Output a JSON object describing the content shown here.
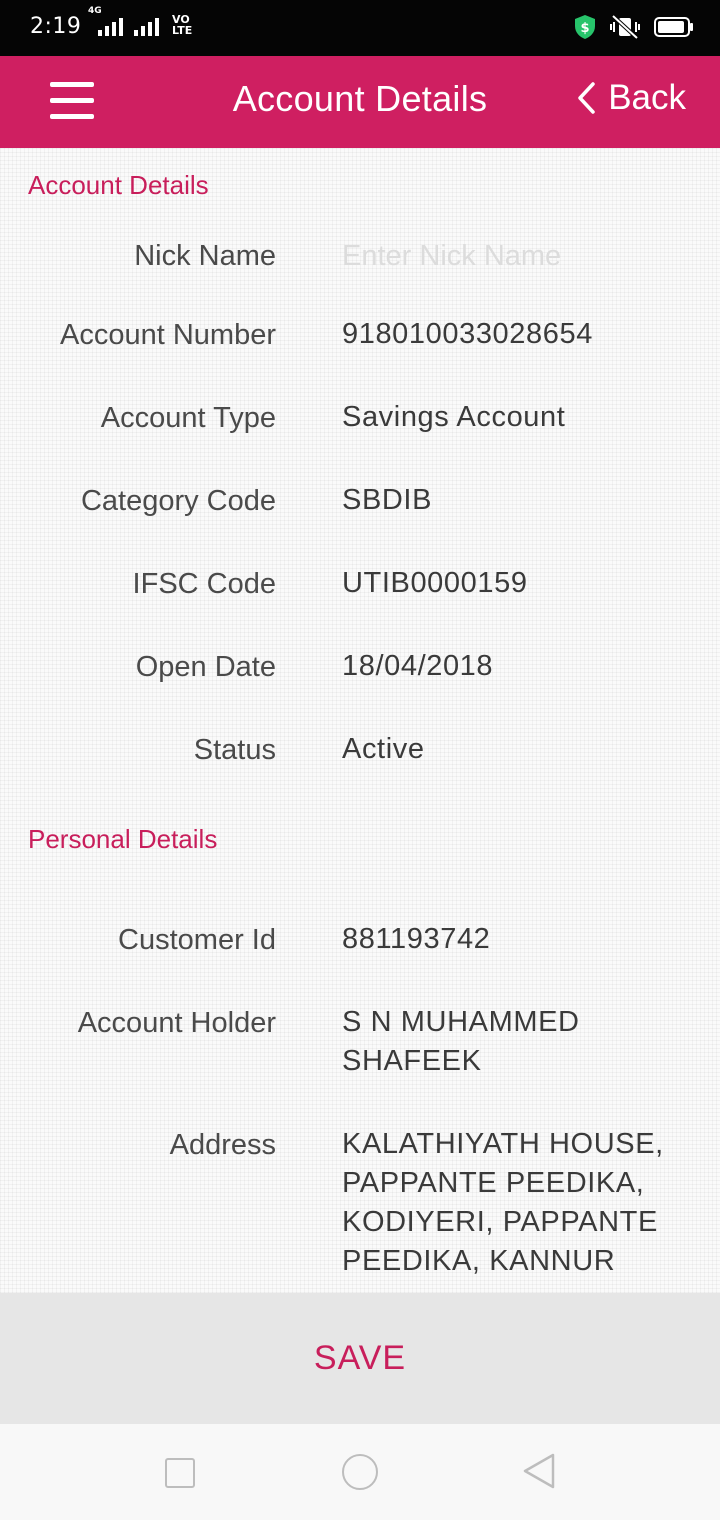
{
  "status_bar": {
    "time": "2:19",
    "network": "4G",
    "volte": "VO\nLTE"
  },
  "header": {
    "title": "Account Details",
    "back_label": "Back",
    "color": "#cf1f61"
  },
  "account_section": {
    "title": "Account Details",
    "nick_name": {
      "label": "Nick Name",
      "value": "",
      "placeholder": "Enter Nick Name"
    },
    "rows": [
      {
        "label": "Account Number",
        "value": "918010033028654"
      },
      {
        "label": "Account Type",
        "value": "Savings Account"
      },
      {
        "label": "Category Code",
        "value": "SBDIB"
      },
      {
        "label": "IFSC Code",
        "value": "UTIB0000159"
      },
      {
        "label": "Open Date",
        "value": "18/04/2018"
      },
      {
        "label": "Status",
        "value": "Active"
      }
    ]
  },
  "personal_section": {
    "title": "Personal Details",
    "rows": [
      {
        "label": "Customer Id",
        "value": "881193742"
      },
      {
        "label": "Account Holder",
        "value": "S N MUHAMMED SHAFEEK"
      },
      {
        "label": "Address",
        "value": "KALATHIYATH HOUSE, PAPPANTE PEEDIKA, KODIYERI, PAPPANTE PEEDIKA, KANNUR"
      }
    ]
  },
  "footer": {
    "save_label": "SAVE"
  },
  "icons": {
    "menu": "hamburger-menu-icon",
    "back": "chevron-left-icon",
    "nav_recent": "square-icon",
    "nav_home": "circle-icon",
    "nav_back": "triangle-back-icon"
  }
}
